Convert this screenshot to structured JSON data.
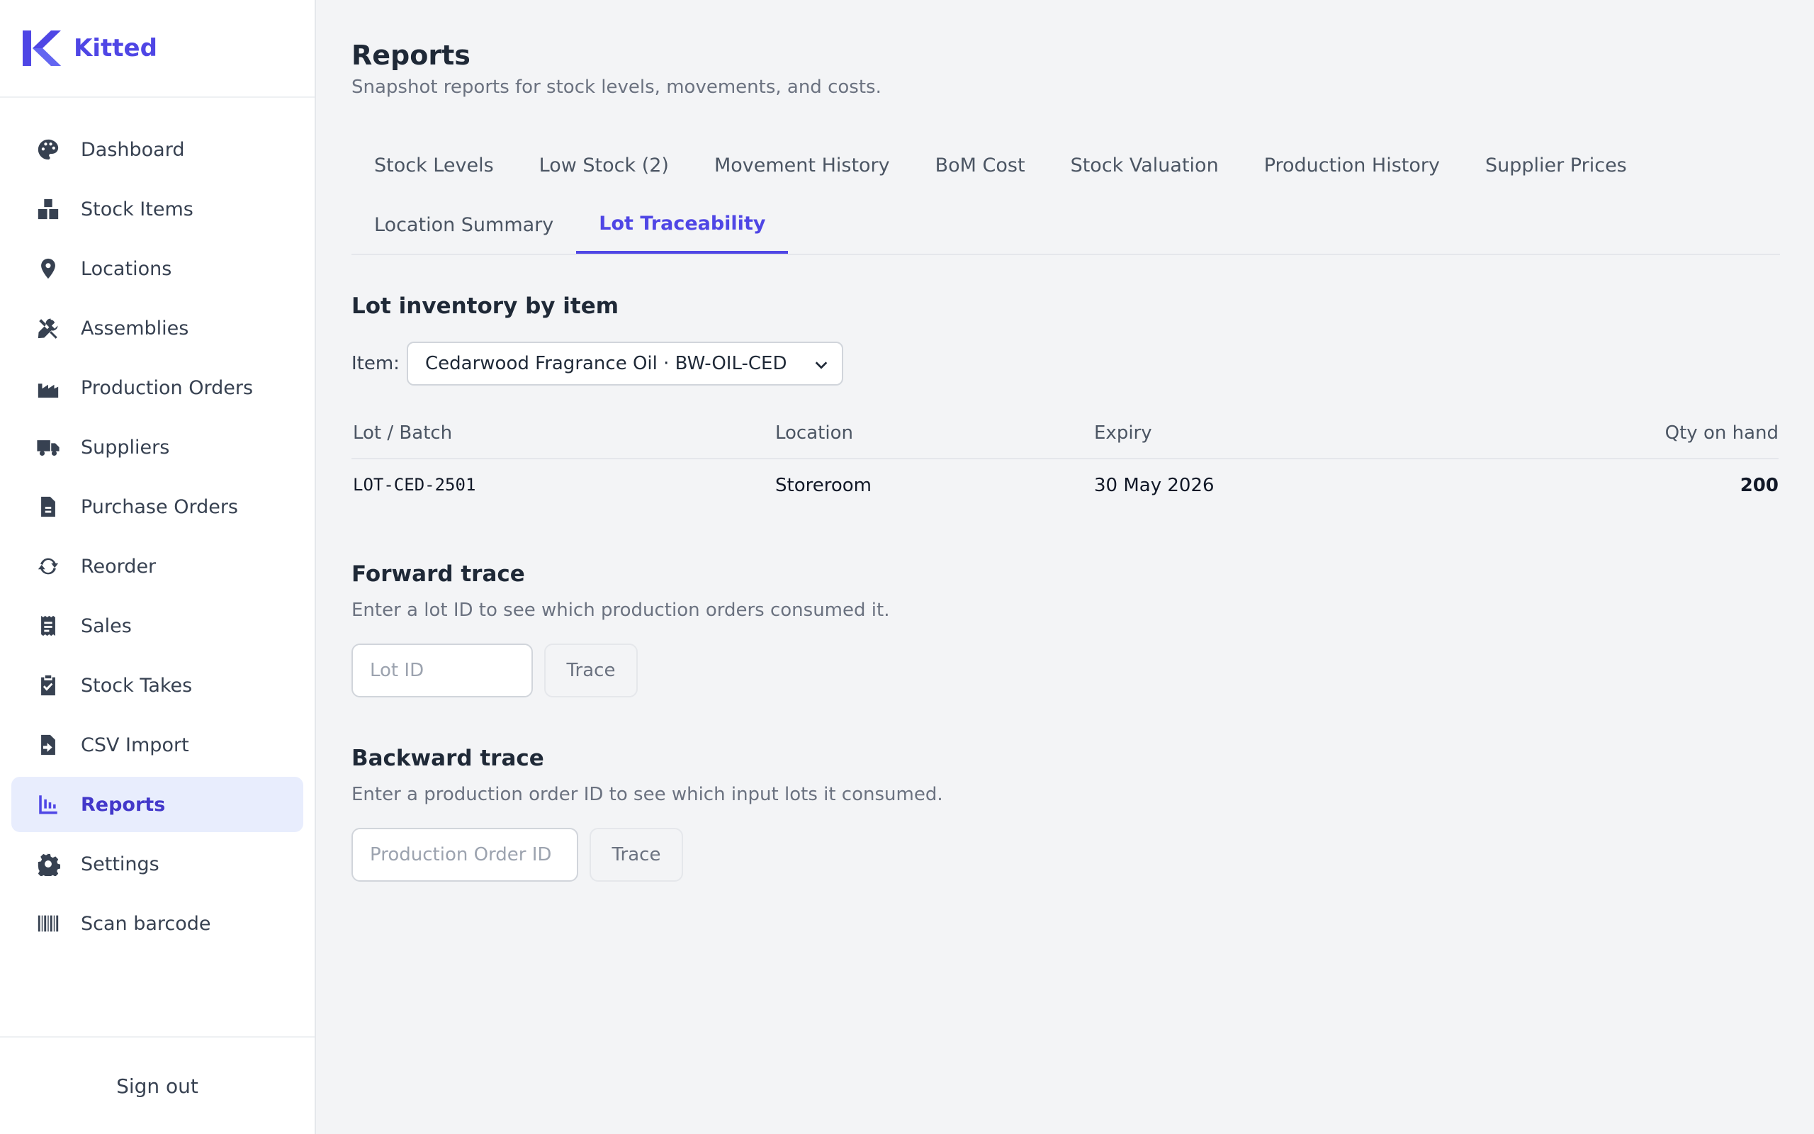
{
  "brand": {
    "name": "Kitted",
    "color": "#4f46e5"
  },
  "sidebar": {
    "items": [
      {
        "label": "Dashboard",
        "icon": "palette-icon"
      },
      {
        "label": "Stock Items",
        "icon": "boxes-icon"
      },
      {
        "label": "Locations",
        "icon": "map-pin-icon"
      },
      {
        "label": "Assemblies",
        "icon": "tools-icon"
      },
      {
        "label": "Production Orders",
        "icon": "factory-icon"
      },
      {
        "label": "Suppliers",
        "icon": "truck-icon"
      },
      {
        "label": "Purchase Orders",
        "icon": "document-icon"
      },
      {
        "label": "Reorder",
        "icon": "refresh-icon"
      },
      {
        "label": "Sales",
        "icon": "receipt-icon"
      },
      {
        "label": "Stock Takes",
        "icon": "clipboard-check-icon"
      },
      {
        "label": "CSV Import",
        "icon": "file-import-icon"
      },
      {
        "label": "Reports",
        "icon": "chart-icon",
        "active": true
      },
      {
        "label": "Settings",
        "icon": "gear-icon"
      },
      {
        "label": "Scan barcode",
        "icon": "barcode-icon"
      }
    ],
    "signout": "Sign out"
  },
  "page": {
    "title": "Reports",
    "subtitle": "Snapshot reports for stock levels, movements, and costs."
  },
  "tabs": {
    "row1": [
      "Stock Levels",
      "Low Stock (2)",
      "Movement History",
      "BoM Cost",
      "Stock Valuation",
      "Production History",
      "Supplier Prices"
    ],
    "row2": [
      "Location Summary",
      "Lot Traceability"
    ],
    "active": "Lot Traceability"
  },
  "lot_inventory": {
    "title": "Lot inventory by item",
    "item_label": "Item:",
    "selected_item": "Cedarwood Fragrance Oil · BW-OIL-CED",
    "columns": [
      "Lot / Batch",
      "Location",
      "Expiry",
      "Qty on hand"
    ],
    "rows": [
      {
        "lot": "LOT-CED-2501",
        "location": "Storeroom",
        "expiry": "30 May 2026",
        "qty": "200"
      }
    ]
  },
  "forward_trace": {
    "title": "Forward trace",
    "description": "Enter a lot ID to see which production orders consumed it.",
    "placeholder": "Lot ID",
    "button": "Trace"
  },
  "backward_trace": {
    "title": "Backward trace",
    "description": "Enter a production order ID to see which input lots it consumed.",
    "placeholder": "Production Order ID",
    "button": "Trace"
  }
}
